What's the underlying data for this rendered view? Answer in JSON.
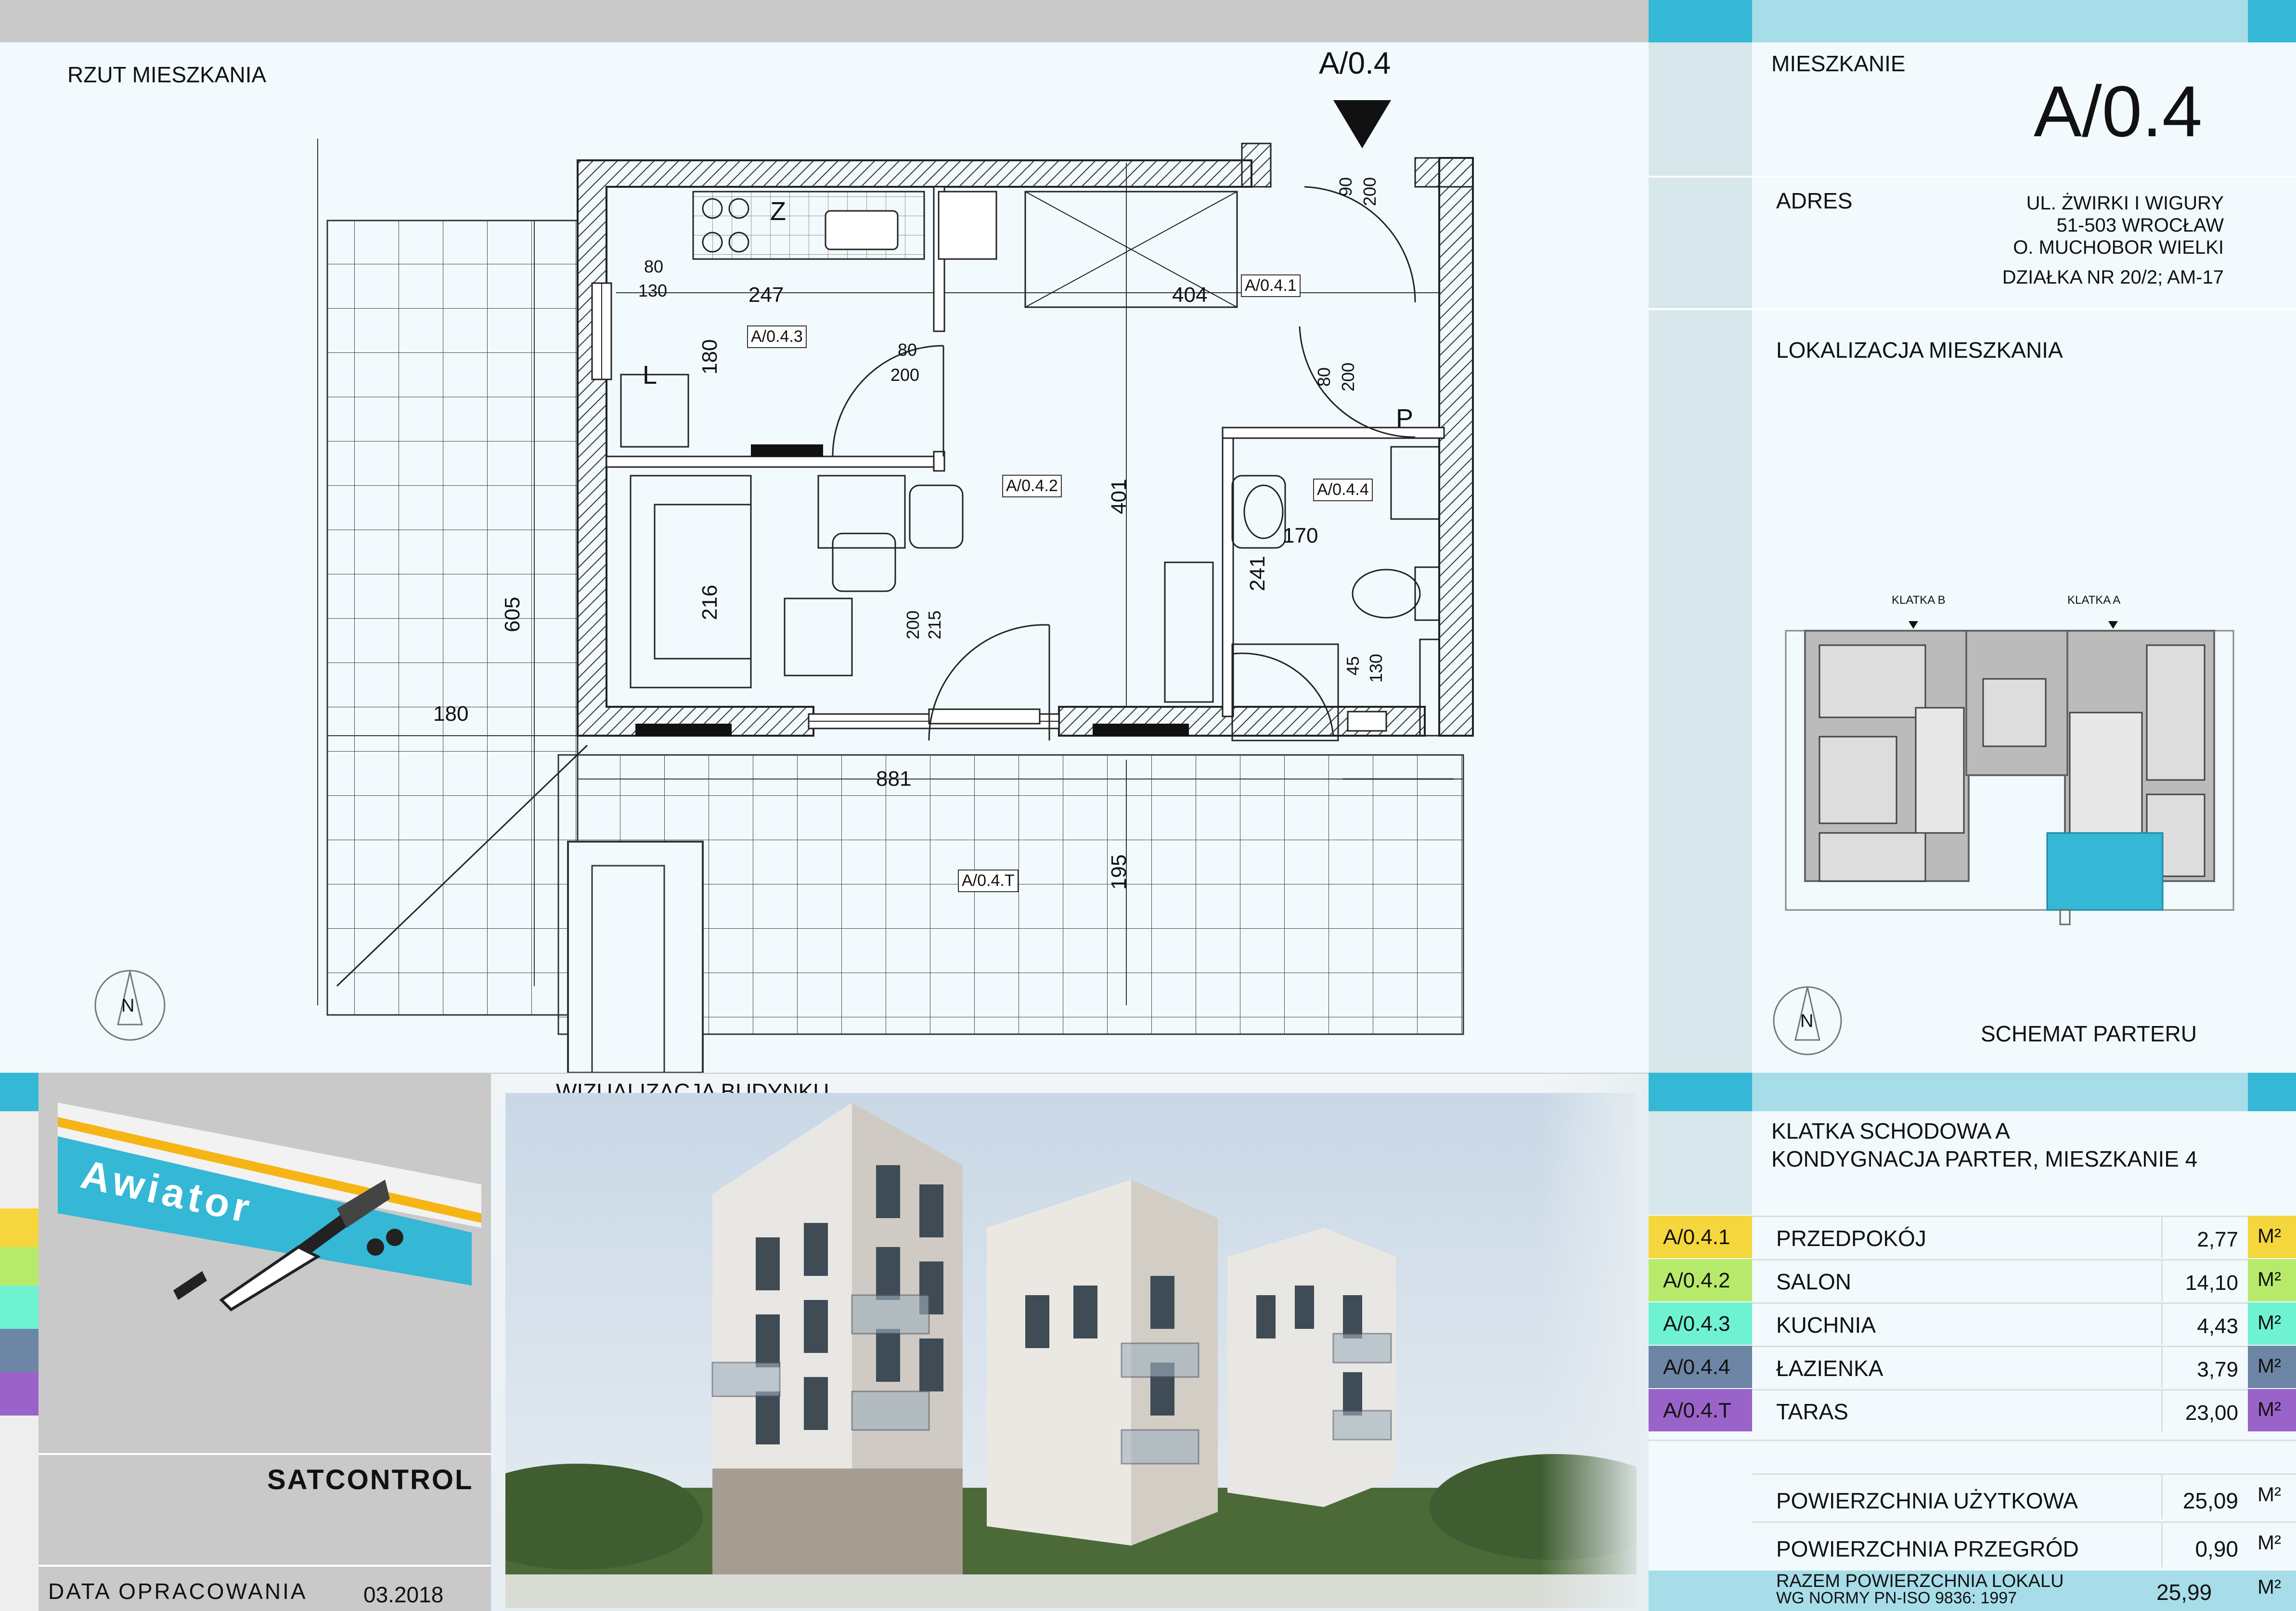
{
  "plan": {
    "title": "RZUT MIESZKANIA",
    "entrance_label": "A/0.4",
    "dims": {
      "d80a": "80",
      "d130a": "130",
      "d247": "247",
      "d404": "404",
      "d180a": "180",
      "d80b": "80",
      "d200b": "200",
      "d90": "90",
      "d200a": "200",
      "d80c": "80",
      "d200c": "200",
      "d170": "170",
      "d241": "241",
      "d401": "401",
      "d216": "216",
      "d200d": "200",
      "d215": "215",
      "d45": "45",
      "d130b": "130",
      "d605": "605",
      "d180b": "180",
      "d881": "881",
      "d195": "195"
    },
    "fixtures": {
      "stove": "Z",
      "fridge": "L",
      "boiler": "P"
    },
    "rooms": [
      "A/0.4.1",
      "A/0.4.2",
      "A/0.4.3",
      "A/0.4.4",
      "A/0.4.T"
    ],
    "north": "N"
  },
  "header": {
    "title_label": "MIESZKANIE",
    "apartment_id": "A/0.4",
    "address_label": "ADRES",
    "address_lines": [
      "UL. ŻWIRKI I WIGURY",
      "51-503 WROCŁAW",
      "O. MUCHOBOR WIELKI",
      "DZIAŁKA NR 20/2; AM-17"
    ]
  },
  "location": {
    "title": "LOKALIZACJA MIESZKANIA",
    "klatka_b": "KLATKA B",
    "klatka_a": "KLATKA A",
    "north": "N",
    "schema_label": "SCHEMAT PARTERU"
  },
  "summary": {
    "line1": "KLATKA SCHODOWA A",
    "line2": "KONDYGNACJA  PARTER, MIESZKANIE 4",
    "unit": "M²",
    "rooms": [
      {
        "code": "A/0.4.1",
        "name": "PRZEDPOKÓJ",
        "area": "2,77",
        "color": "#f5d63d"
      },
      {
        "code": "A/0.4.2",
        "name": "SALON",
        "area": "14,10",
        "color": "#b7ea6a"
      },
      {
        "code": "A/0.4.3",
        "name": "KUCHNIA",
        "area": "4,43",
        "color": "#6ff2d2"
      },
      {
        "code": "A/0.4.4",
        "name": "ŁAZIENKA",
        "area": "3,79",
        "color": "#6d86a6"
      },
      {
        "code": "A/0.4.T",
        "name": "TARAS",
        "area": "23,00",
        "color": "#9a63c9"
      }
    ],
    "totals": [
      {
        "name": "POWIERZCHNIA UŻYTKOWA",
        "area": "25,09"
      },
      {
        "name": "POWIERZCHNIA PRZEGRÓD",
        "area": "0,90"
      }
    ],
    "total_name1": "RAZEM POWIERZCHNIA LOKALU",
    "total_name2": "WG NORMY PN-ISO 9836: 1997",
    "total_area": "25,99"
  },
  "brand": {
    "logo_text": "Awiator",
    "company": "SATCONTROL"
  },
  "footer": {
    "date_label": "DATA OPRACOWANIA",
    "date_value": "03.2018"
  },
  "visual": {
    "title": "WIZUALIZACJA  BUDYNKU"
  },
  "colors": {
    "accent_cyan": "#35b7d6",
    "accent_light": "#a6dde9",
    "panel_bg": "#f2fafd"
  }
}
